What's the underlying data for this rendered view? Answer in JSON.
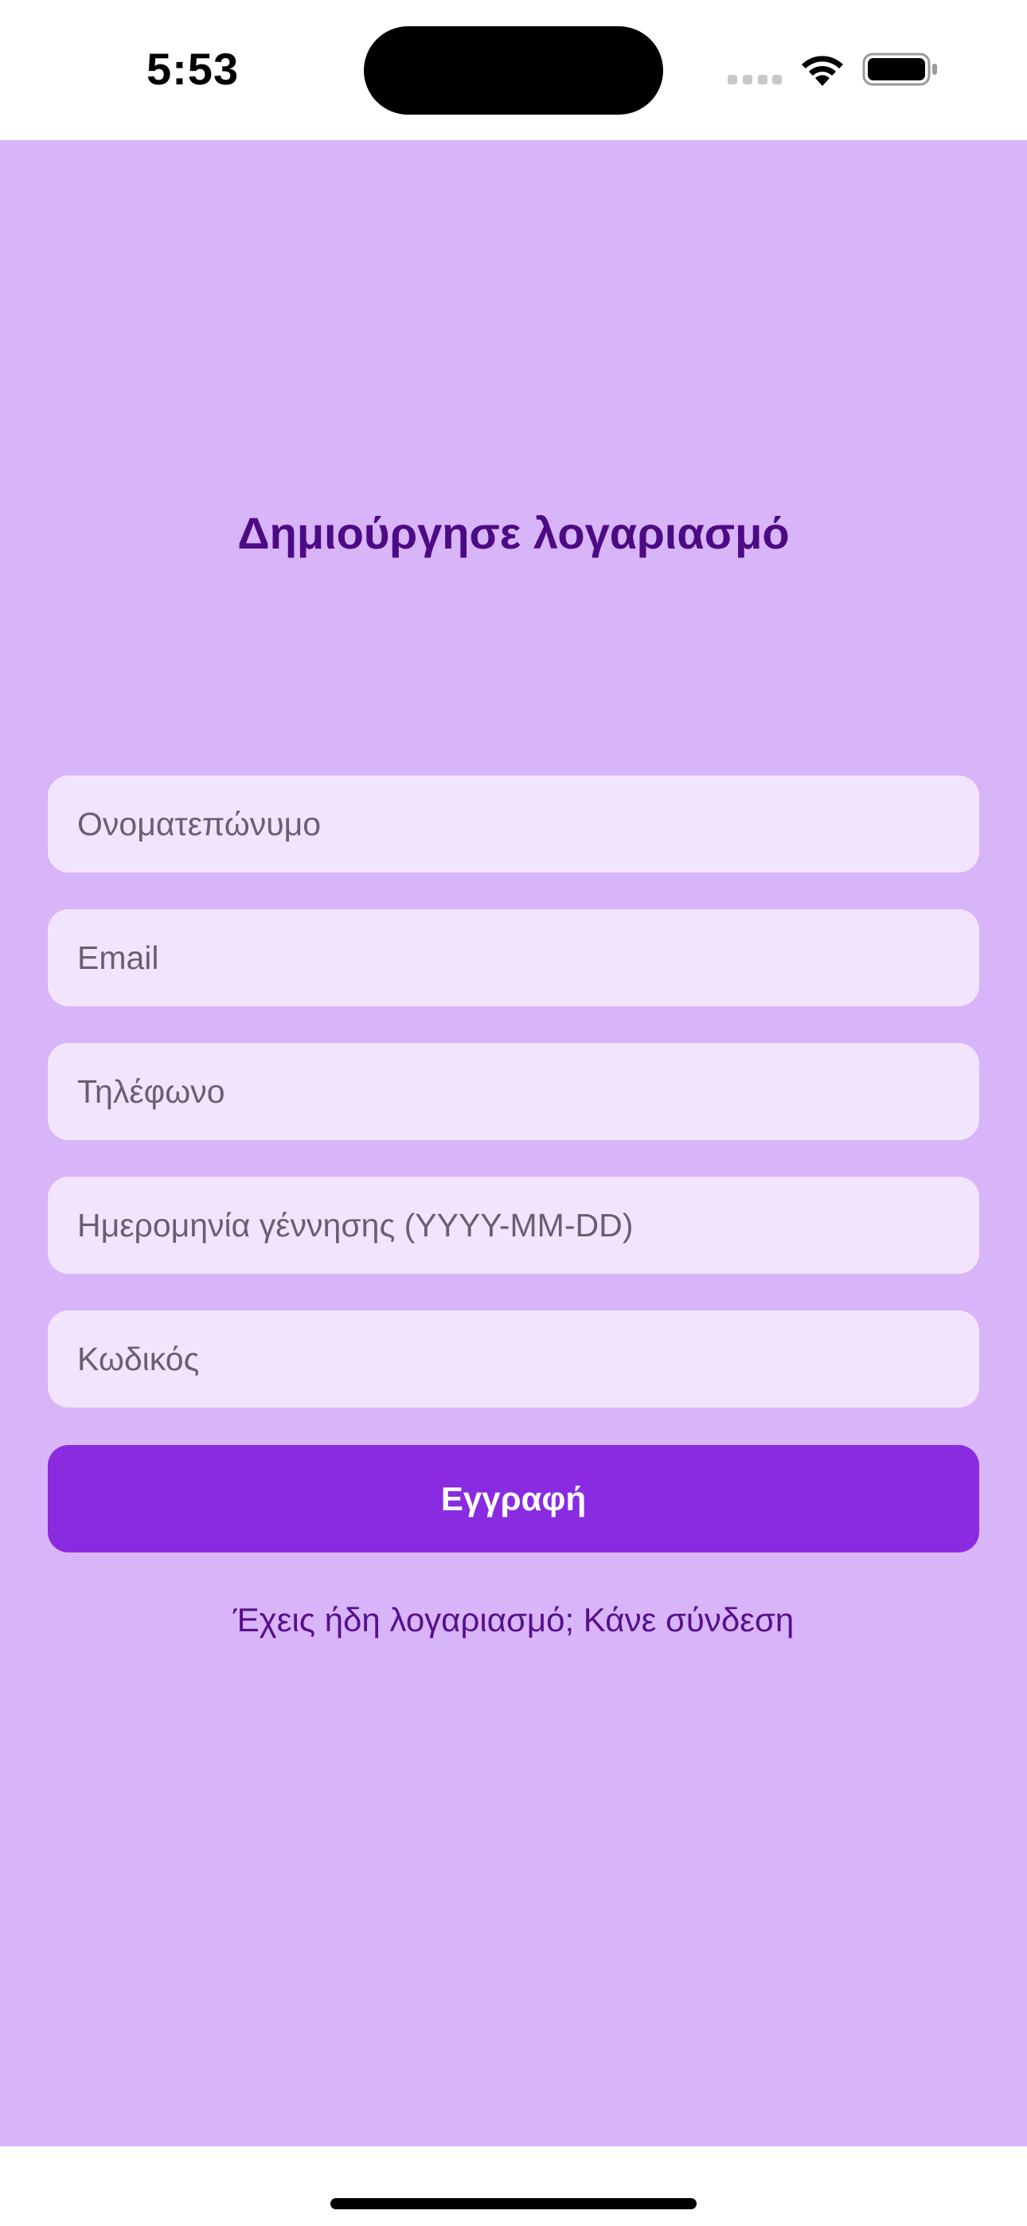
{
  "status_bar": {
    "time": "5:53",
    "icons": [
      "cellular-signal-icon",
      "wifi-icon",
      "battery-icon"
    ]
  },
  "form": {
    "title": "Δημιούργησε λογαριασμό",
    "fields": [
      {
        "name": "full-name",
        "value": "",
        "placeholder": "Ονοματεπώνυμο"
      },
      {
        "name": "email",
        "value": "",
        "placeholder": "Email"
      },
      {
        "name": "phone",
        "value": "",
        "placeholder": "Τηλέφωνο"
      },
      {
        "name": "birthdate",
        "value": "",
        "placeholder": "Ημερομηνία γέννησης (YYYY-MM-DD)"
      },
      {
        "name": "password",
        "value": "",
        "placeholder": "Κωδικός"
      }
    ],
    "submit_label": "Εγγραφή",
    "login_link": "Έχεις ήδη λογαριασμό; Κάνε σύνδεση"
  },
  "colors": {
    "background": "#d8b4f8",
    "field_background": "#f3e4fd",
    "accent": "#8a2be2",
    "title_color": "#4c0a84"
  }
}
